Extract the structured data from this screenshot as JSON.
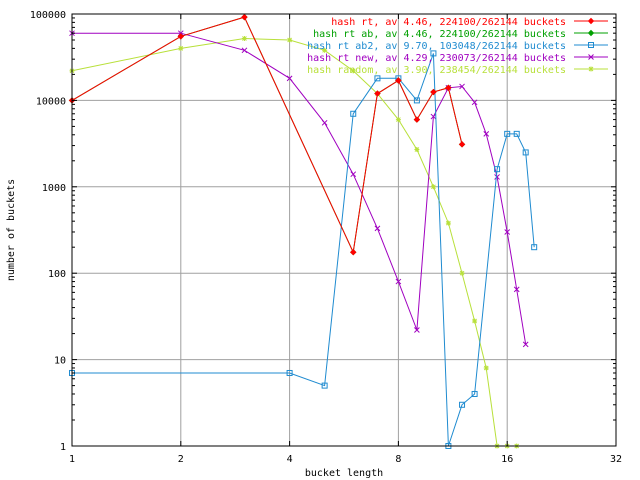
{
  "chart_data": {
    "type": "line",
    "title": "",
    "xlabel": "bucket length",
    "ylabel": "number of buckets",
    "x_scale": "log2",
    "y_scale": "log10",
    "xlim": [
      1,
      32
    ],
    "ylim": [
      1,
      100000
    ],
    "x_ticks": [
      1,
      2,
      4,
      8,
      16,
      32
    ],
    "x_tick_labels": [
      "1",
      "2",
      "4",
      "8",
      "16",
      "32"
    ],
    "y_ticks": [
      1,
      10,
      100,
      1000,
      10000,
      100000
    ],
    "y_tick_labels": [
      "1",
      "10",
      "100",
      "1000",
      "10000",
      "100000"
    ],
    "grid": true,
    "legend_position": "top-right",
    "series": [
      {
        "name": "hash rt, av 4.46, 224100/262144 buckets",
        "color": "#ff0000",
        "marker": "diamond",
        "x": [
          1,
          2,
          3,
          6,
          7,
          8,
          9,
          10,
          11,
          12
        ],
        "y": [
          10000,
          55000,
          92000,
          175,
          12000,
          17000,
          6000,
          12500,
          14000,
          3100
        ]
      },
      {
        "name": "hash rt ab, av 4.46, 224100/262144 buckets",
        "color": "#00a000",
        "marker": "diamond",
        "x": [
          1,
          2,
          3,
          6,
          7,
          8,
          9,
          10,
          11,
          12
        ],
        "y": [
          10000,
          55000,
          92000,
          175,
          12000,
          17000,
          6000,
          12500,
          14000,
          3100
        ]
      },
      {
        "name": "hash rt ab2, av 9.70, 103048/262144 buckets",
        "color": "#1f8bd0",
        "marker": "square",
        "x": [
          1,
          4,
          5,
          6,
          7,
          8,
          9,
          10,
          11,
          12,
          13,
          15,
          16,
          17,
          18,
          19
        ],
        "y": [
          7,
          7,
          5,
          7000,
          18000,
          18000,
          10000,
          35000,
          1,
          3,
          4,
          1600,
          4100,
          4100,
          2500,
          200
        ]
      },
      {
        "name": "hash rt new, av 4.29, 230073/262144 buckets",
        "color": "#a000c0",
        "marker": "x",
        "x": [
          1,
          2,
          3,
          4,
          5,
          6,
          7,
          8,
          9,
          10,
          11,
          12,
          13,
          14,
          15,
          16,
          17,
          18
        ],
        "y": [
          60000,
          60000,
          38000,
          18000,
          5500,
          1400,
          330,
          80,
          22,
          6500,
          14000,
          14500,
          9500,
          4100,
          1300,
          300,
          65,
          15
        ]
      },
      {
        "name": "hash random, av 3.90, 238454/262144 buckets",
        "color": "#b8e03a",
        "marker": "star",
        "x": [
          1,
          2,
          3,
          4,
          5,
          6,
          7,
          8,
          9,
          10,
          11,
          12,
          13,
          14,
          15,
          16,
          17
        ],
        "y": [
          22000,
          40000,
          52000,
          50000,
          38000,
          22000,
          12000,
          6000,
          2700,
          1000,
          380,
          100,
          28,
          8,
          1,
          1,
          1
        ]
      }
    ]
  }
}
